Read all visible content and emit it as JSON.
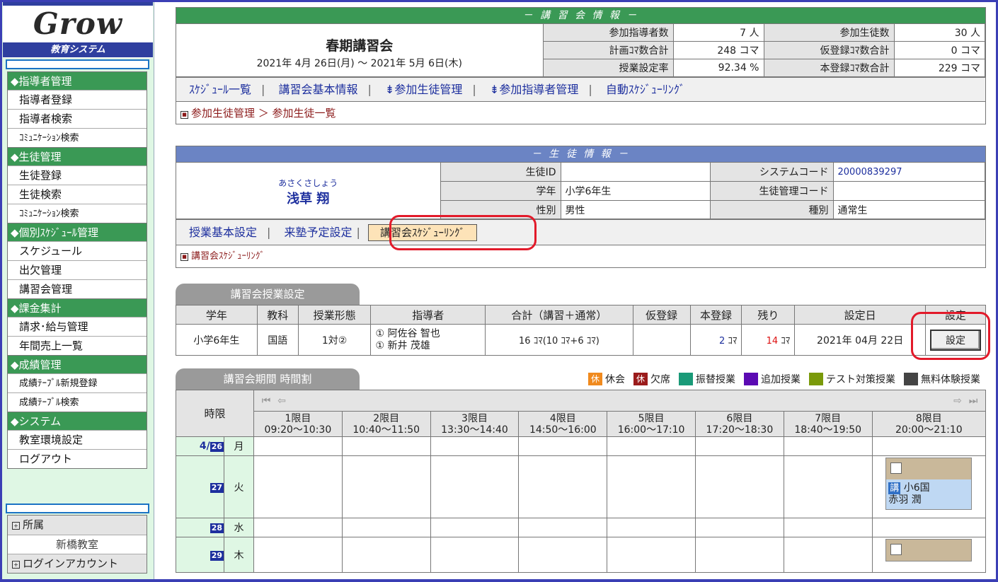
{
  "sidebar": {
    "logo": "Grow",
    "logo_sub": "教育システム",
    "groups": [
      {
        "title": "◆指導者管理",
        "items": [
          "指導者登録",
          "指導者検索",
          "ｺﾐｭﾆｹｰｼｮﾝ検索"
        ]
      },
      {
        "title": "◆生徒管理",
        "items": [
          "生徒登録",
          "生徒検索",
          "ｺﾐｭﾆｹｰｼｮﾝ検索"
        ]
      },
      {
        "title": "◆個別ｽｹｼﾞｭｰﾙ管理",
        "items": [
          "スケジュール",
          "出欠管理",
          "講習会管理"
        ]
      },
      {
        "title": "◆課金集計",
        "items": [
          "請求･給与管理",
          "年間売上一覧"
        ]
      },
      {
        "title": "◆成績管理",
        "items": [
          "成績ﾃｰﾌﾞﾙ新規登録",
          "成績ﾃｰﾌﾞﾙ検索"
        ]
      },
      {
        "title": "◆システム",
        "items": [
          "教室環境設定",
          "ログアウト"
        ]
      }
    ],
    "affiliation_label": "所属",
    "affiliation_value": "新橋教室",
    "login_label": "ログインアカウント"
  },
  "course": {
    "header": "－ 講 習 会 情 報 －",
    "name": "春期講習会",
    "period": "2021年 4月 26日(月) ～ 2021年 5月 6日(木)",
    "stats": [
      {
        "label": "参加指導者数",
        "value": "7 人",
        "label2": "参加生徒数",
        "value2": "30 人"
      },
      {
        "label": "計画ｺﾏ数合計",
        "value": "248 コマ",
        "label2": "仮登録ｺﾏ数合計",
        "value2": "0 コマ"
      },
      {
        "label": "授業設定率",
        "value": "92.34 %",
        "label2": "本登録ｺﾏ数合計",
        "value2": "229 コマ"
      }
    ],
    "tabs": [
      "ｽｹｼﾞｭｰﾙ一覧",
      "講習会基本情報",
      "⇟参加生徒管理",
      "⇟参加指導者管理",
      "自動ｽｹｼﾞｭｰﾘﾝｸﾞ"
    ],
    "breadcrumb": "参加生徒管理 ＞ 参加生徒一覧"
  },
  "student": {
    "header": "－ 生 徒 情 報 －",
    "kana": "あさくさしょう",
    "name": "浅草 翔",
    "fields": [
      {
        "label": "生徒ID",
        "value": "",
        "label2": "システムコード",
        "value2": "20000839297"
      },
      {
        "label": "学年",
        "value": "小学6年生",
        "label2": "生徒管理コード",
        "value2": ""
      },
      {
        "label": "性別",
        "value": "男性",
        "label2": "種別",
        "value2": "通常生"
      }
    ],
    "tabs": [
      "授業基本設定",
      "来塾予定設定",
      "講習会ｽｹｼﾞｭｰﾘﾝｸﾞ"
    ],
    "breadcrumb": "講習会ｽｹｼﾞｭｰﾘﾝｸﾞ"
  },
  "class_settings": {
    "tab": "講習会授業設定",
    "headers": [
      "学年",
      "教科",
      "授業形態",
      "指導者",
      "合計（講習＋通常）",
      "仮登録",
      "本登録",
      "残り",
      "設定日",
      "設定"
    ],
    "row": {
      "grade": "小学6年生",
      "subject": "国語",
      "form": "1対②",
      "teacher1": "① 阿佐谷 智也",
      "teacher2": "① 新井 茂雄",
      "total": "16 ｺﾏ(10 ｺﾏ+6 ｺﾏ)",
      "temp": "",
      "main_num": "2",
      "main_unit": "ｺﾏ",
      "rest_num": "14",
      "rest_unit": "ｺﾏ",
      "date": "2021年 04月 22日",
      "button": "設定"
    }
  },
  "timetable": {
    "tab": "講習会期間 時間割",
    "legend": [
      {
        "icon": "休",
        "label": "休会",
        "color": "#f08a1e"
      },
      {
        "icon": "休",
        "label": "欠席",
        "color": "#9b1c1c"
      },
      {
        "icon": "",
        "label": "振替授業",
        "color": "#1a9a78"
      },
      {
        "icon": "",
        "label": "追加授業",
        "color": "#5b0ab3"
      },
      {
        "icon": "",
        "label": "テスト対策授業",
        "color": "#7a9a0a"
      },
      {
        "icon": "",
        "label": "無料体験授業",
        "color": "#444444"
      }
    ],
    "period_label": "時限",
    "periods": [
      {
        "name": "1限目",
        "time": "09:20～10:30"
      },
      {
        "name": "2限目",
        "time": "10:40～11:50"
      },
      {
        "name": "3限目",
        "time": "13:30～14:40"
      },
      {
        "name": "4限目",
        "time": "14:50～16:00"
      },
      {
        "name": "5限目",
        "time": "16:00～17:10"
      },
      {
        "name": "6限目",
        "time": "17:20～18:30"
      },
      {
        "name": "7限目",
        "time": "18:40～19:50"
      },
      {
        "name": "8限目",
        "time": "20:00～21:10"
      }
    ],
    "days": [
      {
        "month": "4/",
        "day": "26",
        "weekday": "月"
      },
      {
        "month": "",
        "day": "27",
        "weekday": "火"
      },
      {
        "month": "",
        "day": "28",
        "weekday": "水"
      },
      {
        "month": "",
        "day": "29",
        "weekday": "木"
      }
    ],
    "lesson": {
      "kou": "講",
      "class": "小6国",
      "teacher": "赤羽 潤"
    }
  }
}
